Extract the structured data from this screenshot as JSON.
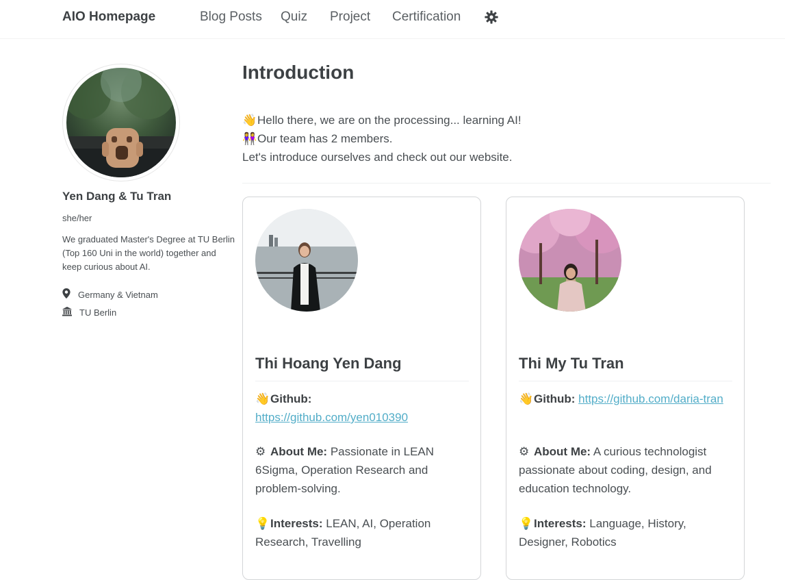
{
  "nav": {
    "site_title": "AIO Homepage",
    "links": [
      "Blog Posts",
      "Quiz",
      "Project",
      "Certification"
    ],
    "theme_toggle_icon": "gear-icon"
  },
  "sidebar": {
    "name": "Yen Dang & Tu Tran",
    "pronouns": "she/her",
    "bio": "We graduated Master's Degree at TU Berlin (Top 160 Uni in the world) together and keep curious about AI.",
    "location": "Germany & Vietnam",
    "location_icon": "map-marker-icon",
    "university": "TU Berlin",
    "university_icon": "university-icon"
  },
  "main": {
    "title": "Introduction",
    "intro": [
      {
        "emoji": "👋",
        "text": "Hello there, we are on the processing... learning AI!"
      },
      {
        "emoji": "👭",
        "text": "Our team has 2 members."
      },
      {
        "emoji": "",
        "text": "Let's introduce ourselves and check out our website."
      }
    ]
  },
  "members": [
    {
      "name": "Thi Hoang Yen Dang",
      "github_label": "Github:",
      "github_emoji": "👋",
      "github_url": "https://github.com/yen010390",
      "about_label": "About Me:",
      "about_emoji": "⚙",
      "about": "Passionate in LEAN 6Sigma, Operation Research and problem-solving.",
      "interests_label": "Interests:",
      "interests_emoji": "💡",
      "interests": "LEAN, AI, Operation Research, Travelling"
    },
    {
      "name": "Thi My Tu Tran",
      "github_label": "Github:",
      "github_emoji": "👋",
      "github_url": "https://github.com/daria-tran",
      "about_label": "About Me:",
      "about_emoji": "⚙",
      "about": "A curious technologist passionate about coding, design, and education technology.",
      "interests_label": "Interests:",
      "interests_emoji": "💡",
      "interests": "Language, History, Designer, Robotics"
    }
  ],
  "colors": {
    "link": "#52adc8",
    "text": "#494e52",
    "heading": "#3d4144",
    "card_border": "#d3d5d7"
  }
}
